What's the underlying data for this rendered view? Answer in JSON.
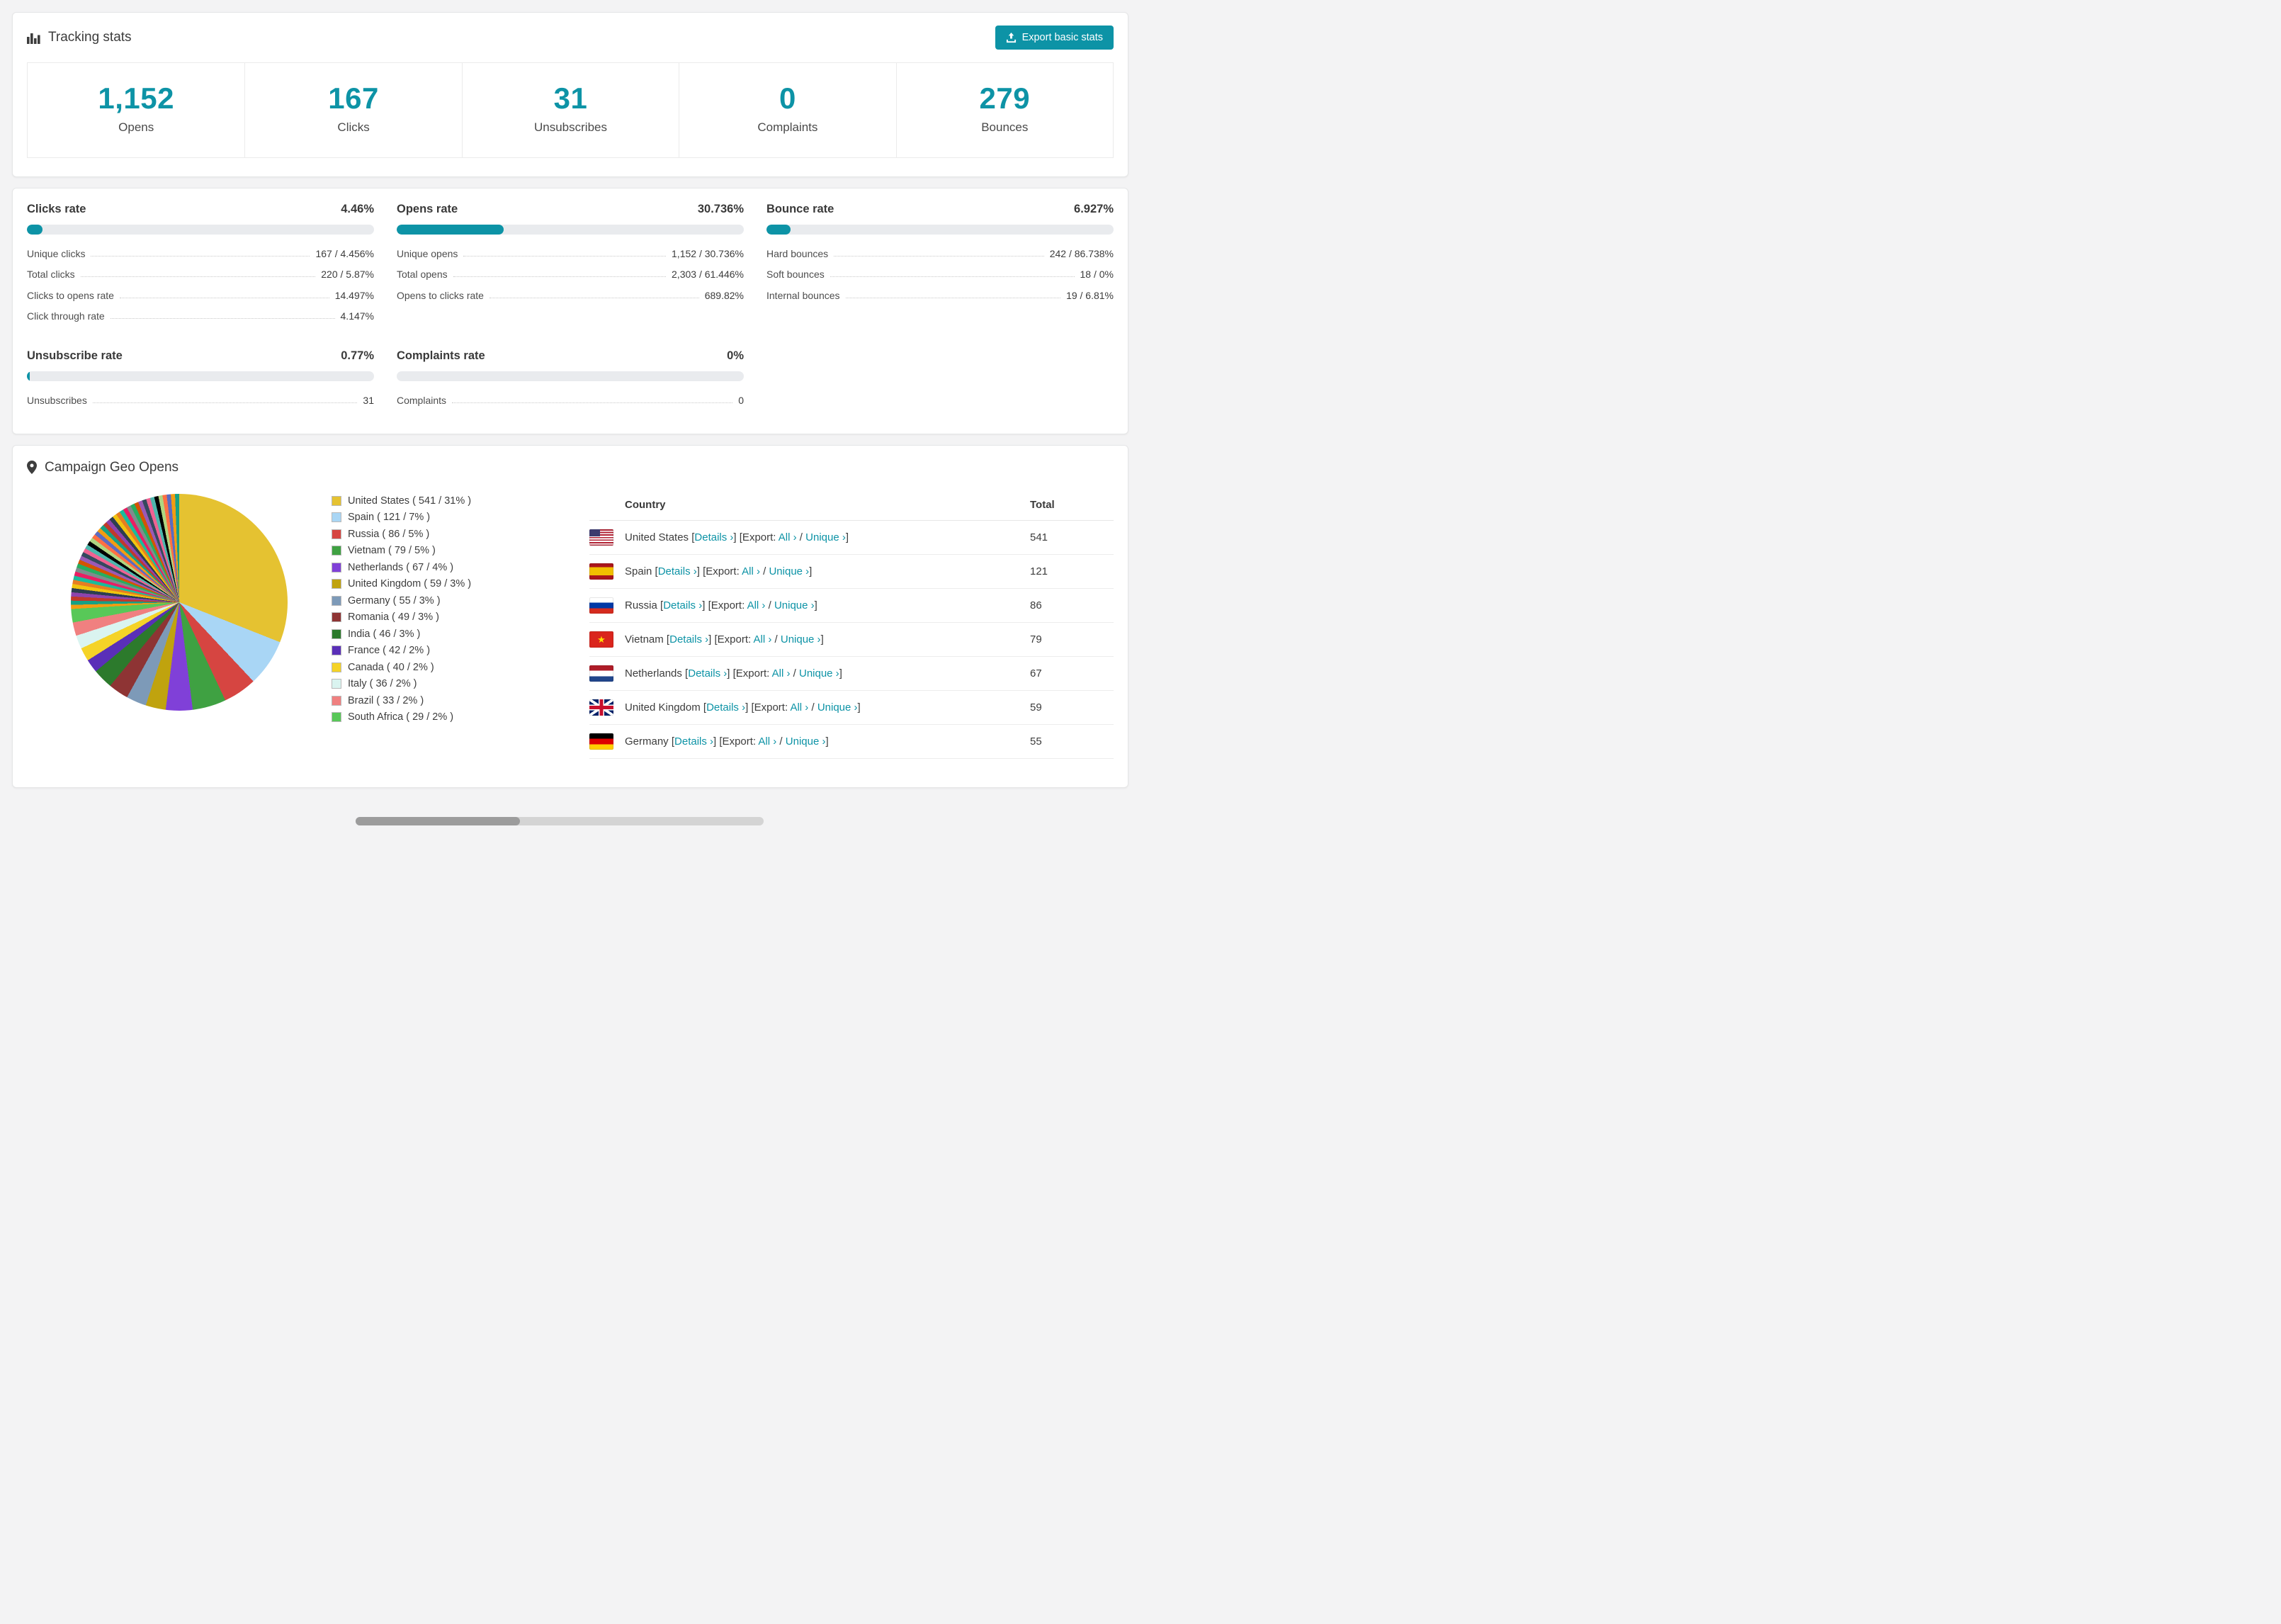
{
  "colors": {
    "accent": "#0d93a6"
  },
  "tracking": {
    "title": "Tracking stats",
    "export_label": "Export basic stats",
    "stats": [
      {
        "value": "1,152",
        "label": "Opens"
      },
      {
        "value": "167",
        "label": "Clicks"
      },
      {
        "value": "31",
        "label": "Unsubscribes"
      },
      {
        "value": "0",
        "label": "Complaints"
      },
      {
        "value": "279",
        "label": "Bounces"
      }
    ]
  },
  "rates": [
    {
      "title": "Clicks rate",
      "value": "4.46%",
      "percent": 4.46,
      "rows": [
        {
          "label": "Unique clicks",
          "value": "167 / 4.456%"
        },
        {
          "label": "Total clicks",
          "value": "220 / 5.87%"
        },
        {
          "label": "Clicks to opens rate",
          "value": "14.497%"
        },
        {
          "label": "Click through rate",
          "value": "4.147%"
        }
      ]
    },
    {
      "title": "Opens rate",
      "value": "30.736%",
      "percent": 30.736,
      "rows": [
        {
          "label": "Unique opens",
          "value": "1,152 / 30.736%"
        },
        {
          "label": "Total opens",
          "value": "2,303 / 61.446%"
        },
        {
          "label": "Opens to clicks rate",
          "value": "689.82%"
        }
      ]
    },
    {
      "title": "Bounce rate",
      "value": "6.927%",
      "percent": 6.927,
      "rows": [
        {
          "label": "Hard bounces",
          "value": "242 / 86.738%"
        },
        {
          "label": "Soft bounces",
          "value": "18 / 0%"
        },
        {
          "label": "Internal bounces",
          "value": "19 / 6.81%"
        }
      ]
    },
    {
      "title": "Unsubscribe rate",
      "value": "0.77%",
      "percent": 0.77,
      "rows": [
        {
          "label": "Unsubscribes",
          "value": "31"
        }
      ]
    },
    {
      "title": "Complaints rate",
      "value": "0%",
      "percent": 0,
      "rows": [
        {
          "label": "Complaints",
          "value": "0"
        }
      ]
    }
  ],
  "geo": {
    "title": "Campaign Geo Opens",
    "legend_format": "{label} ( {count} / {percent}% )",
    "chart_data": {
      "type": "pie",
      "slices": [
        {
          "label": "United States",
          "count": 541,
          "percent": 31,
          "color": "#e5c231"
        },
        {
          "label": "Spain",
          "count": 121,
          "percent": 7,
          "color": "#a9d6f5"
        },
        {
          "label": "Russia",
          "count": 86,
          "percent": 5,
          "color": "#d64541"
        },
        {
          "label": "Vietnam",
          "count": 79,
          "percent": 5,
          "color": "#3fa142"
        },
        {
          "label": "Netherlands",
          "count": 67,
          "percent": 4,
          "color": "#8040d8"
        },
        {
          "label": "United Kingdom",
          "count": 59,
          "percent": 3,
          "color": "#c0a30e"
        },
        {
          "label": "Germany",
          "count": 55,
          "percent": 3,
          "color": "#7d9ab8"
        },
        {
          "label": "Romania",
          "count": 49,
          "percent": 3,
          "color": "#8e3434"
        },
        {
          "label": "India",
          "count": 46,
          "percent": 3,
          "color": "#2c7a2c"
        },
        {
          "label": "France",
          "count": 42,
          "percent": 2,
          "color": "#5a2fb8"
        },
        {
          "label": "Canada",
          "count": 40,
          "percent": 2,
          "color": "#f5d327"
        },
        {
          "label": "Italy",
          "count": 36,
          "percent": 2,
          "color": "#daf4f0"
        },
        {
          "label": "Brazil",
          "count": 33,
          "percent": 2,
          "color": "#f08080"
        },
        {
          "label": "South Africa",
          "count": 29,
          "percent": 2,
          "color": "#58c858"
        }
      ],
      "others_percent": 26,
      "others_slice_count": 42,
      "others_palette": [
        "#f39c12",
        "#16a085",
        "#c0392b",
        "#8e44ad",
        "#2c3e50",
        "#f1c40f",
        "#e67e22",
        "#1abc9c",
        "#e91e63",
        "#7f8c8d",
        "#27ae60",
        "#d35400",
        "#9b59b6",
        "#34495e",
        "#f06292",
        "#4db6ac",
        "#000000",
        "#aed581",
        "#ff7043",
        "#5c6bc0"
      ]
    },
    "table": {
      "country_header": "Country",
      "total_header": "Total",
      "details_label": "Details ›",
      "export_prefix": "[Export:",
      "all_label": "All ›",
      "unique_label": "Unique ›",
      "rows": [
        {
          "country": "United States",
          "flag": "us",
          "total": "541"
        },
        {
          "country": "Spain",
          "flag": "es",
          "total": "121"
        },
        {
          "country": "Russia",
          "flag": "ru",
          "total": "86"
        },
        {
          "country": "Vietnam",
          "flag": "vn",
          "total": "79"
        },
        {
          "country": "Netherlands",
          "flag": "nl",
          "total": "67"
        },
        {
          "country": "United Kingdom",
          "flag": "gb",
          "total": "59"
        },
        {
          "country": "Germany",
          "flag": "de",
          "total": "55"
        }
      ]
    }
  }
}
